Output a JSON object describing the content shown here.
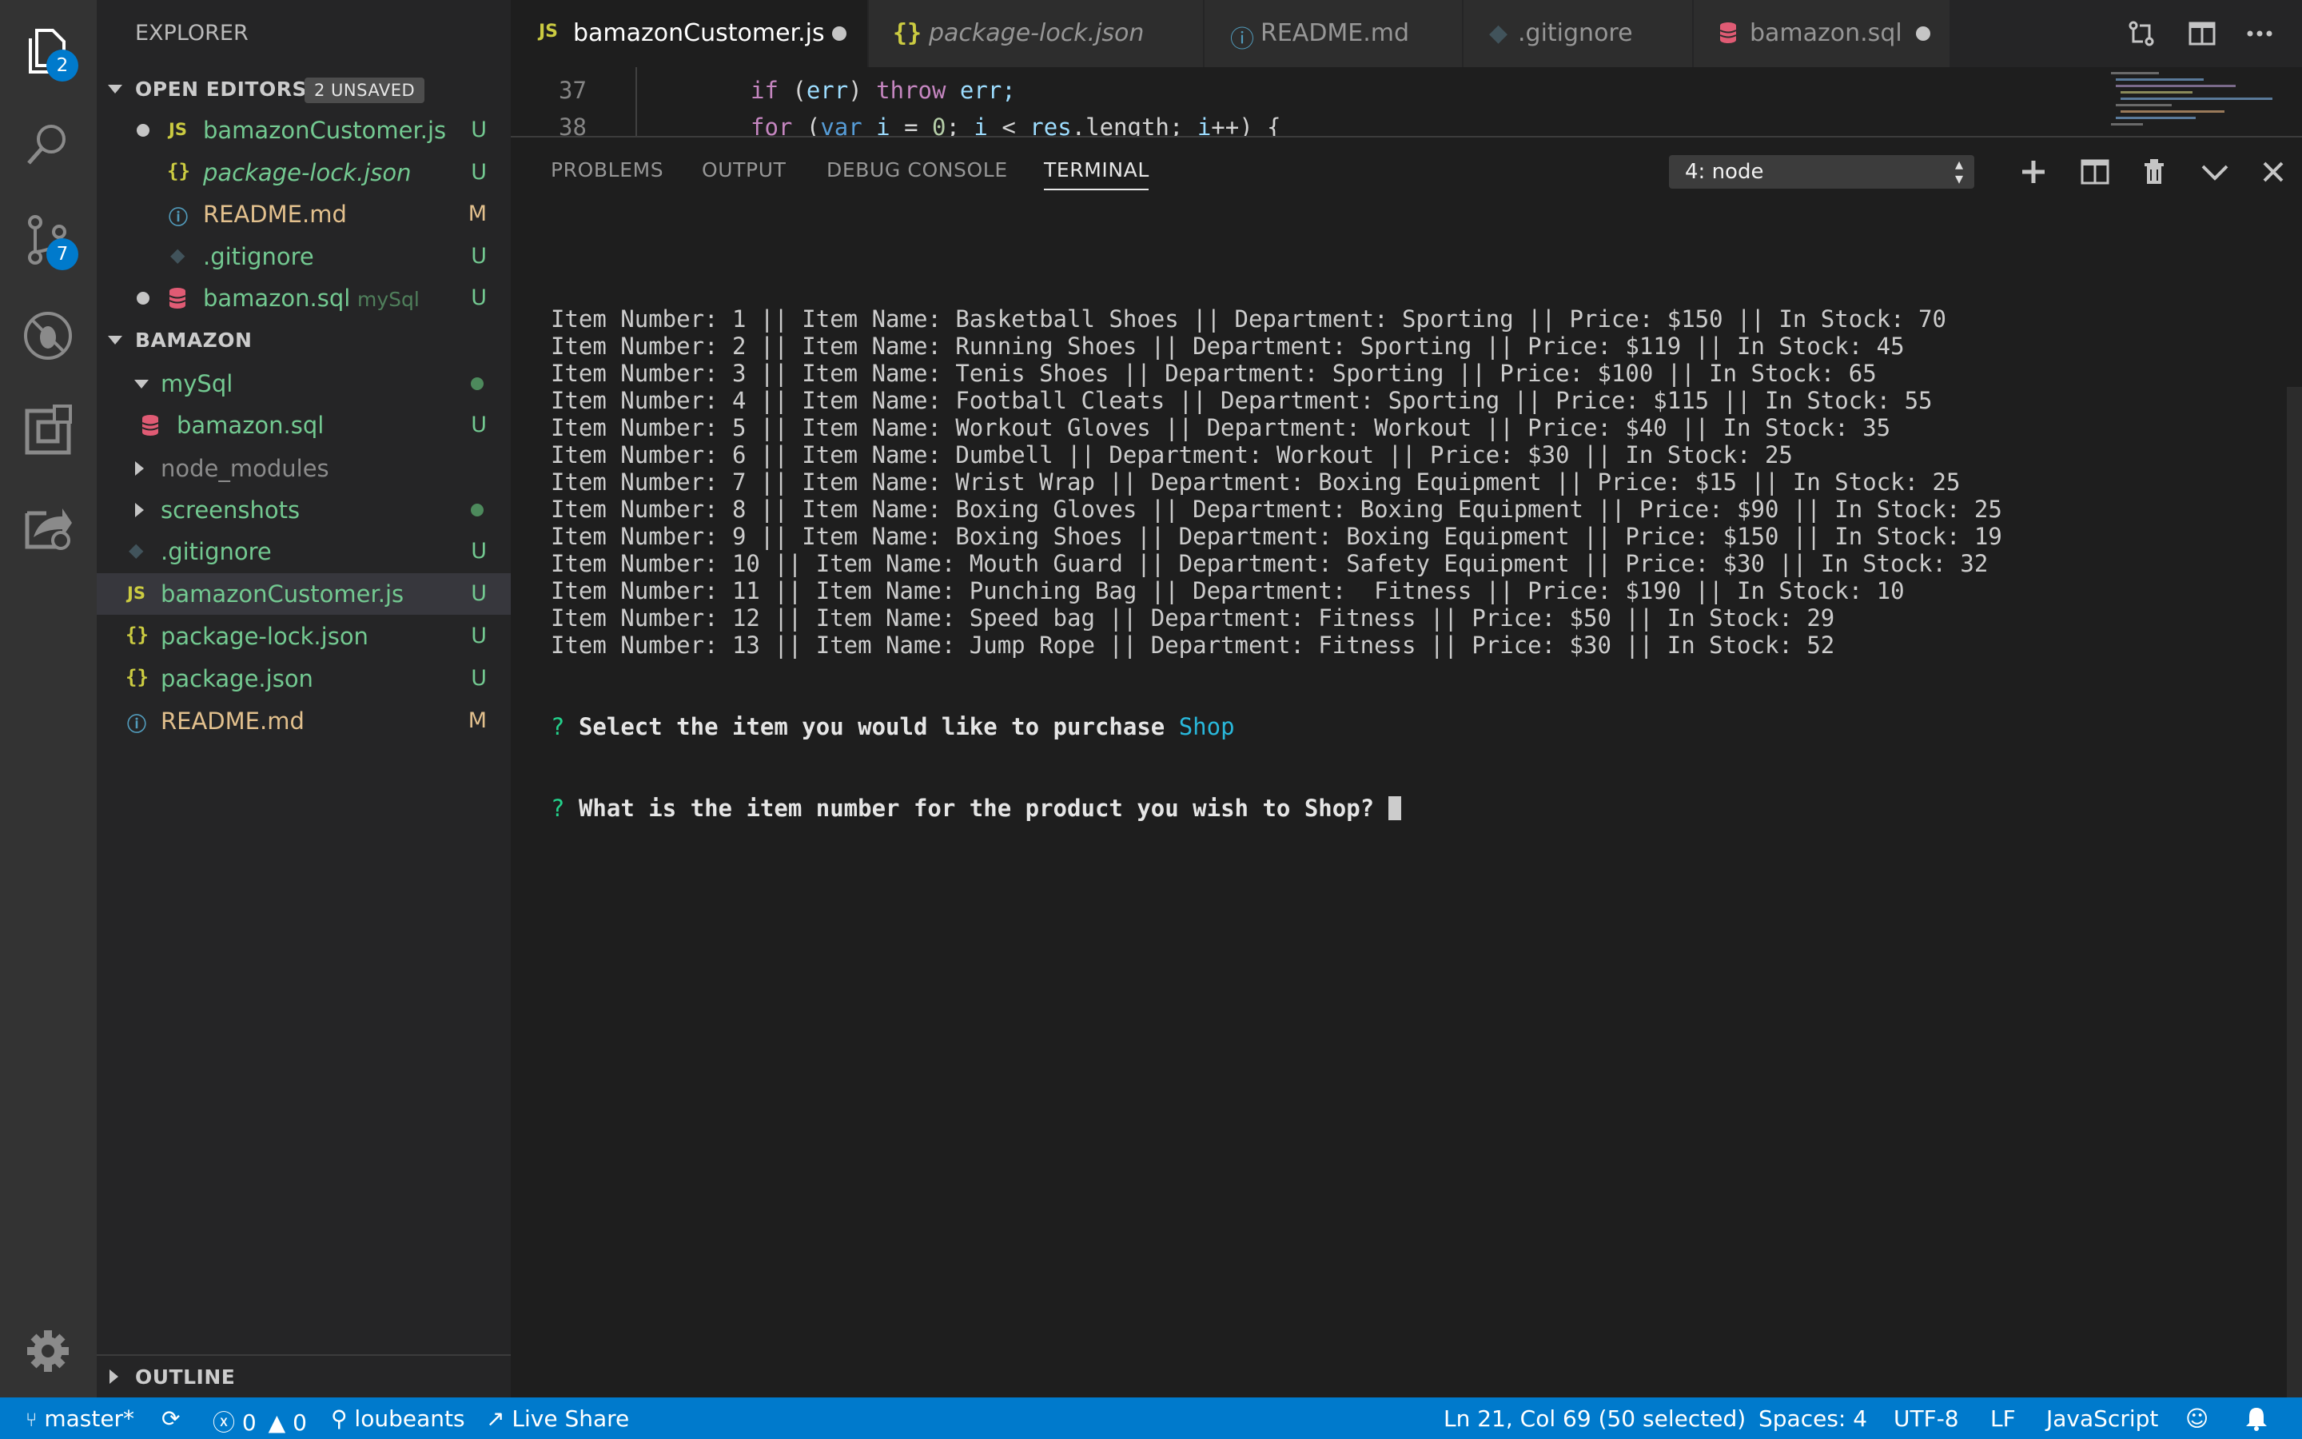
{
  "activity_bar": {
    "explorer_badge": "2",
    "scm_badge": "7"
  },
  "sidebar": {
    "title": "EXPLORER",
    "open_editors": {
      "header": "OPEN EDITORS",
      "unsaved_badge": "2 UNSAVED",
      "items": [
        {
          "name": "bamazonCustomer.js",
          "status": "U",
          "dirty": true
        },
        {
          "name": "package-lock.json",
          "status": "U"
        },
        {
          "name": "README.md",
          "status": "M"
        },
        {
          "name": ".gitignore",
          "status": "U"
        },
        {
          "name": "bamazon.sql",
          "desc": "mySql",
          "status": "U",
          "dirty": true
        }
      ]
    },
    "project": {
      "header": "BAMAZON",
      "items": [
        {
          "name": "mySql"
        },
        {
          "name": "bamazon.sql",
          "status": "U"
        },
        {
          "name": "node_modules"
        },
        {
          "name": "screenshots"
        },
        {
          "name": ".gitignore",
          "status": "U"
        },
        {
          "name": "bamazonCustomer.js",
          "status": "U"
        },
        {
          "name": "package-lock.json",
          "status": "U"
        },
        {
          "name": "package.json",
          "status": "U"
        },
        {
          "name": "README.md",
          "status": "M"
        }
      ]
    },
    "outline_header": "OUTLINE"
  },
  "tabs": [
    {
      "label": "bamazonCustomer.js",
      "icon": "JS"
    },
    {
      "label": "package-lock.json",
      "icon": "{}"
    },
    {
      "label": "README.md",
      "icon": "info"
    },
    {
      "label": ".gitignore",
      "icon": "git"
    },
    {
      "label": "bamazon.sql",
      "icon": "database"
    }
  ],
  "editor": {
    "line_numbers": [
      "37",
      "38"
    ],
    "line37": {
      "indent": "    ",
      "kw_if": "if",
      "open": " (",
      "var_err": "err",
      "close": ") ",
      "kw_throw": "throw",
      "rest": " err;"
    },
    "line38": {
      "indent": "    ",
      "kw_for": "for",
      "p1": " (",
      "kw_var": "var",
      "p2": " ",
      "var_i": "i",
      "p3": " = ",
      "zero": "0",
      "p4": "; ",
      "var_i2": "i",
      "p5": " < ",
      "var_res": "res",
      "p6": ".length; ",
      "var_i3": "i",
      "p7": "++) {"
    }
  },
  "panel": {
    "tabs": [
      "PROBLEMS",
      "OUTPUT",
      "DEBUG CONSOLE",
      "TERMINAL"
    ],
    "terminal_select": "4: node",
    "terminal_lines": [
      "Item Number: 1 || Item Name: Basketball Shoes || Department: Sporting || Price: $150 || In Stock: 70",
      "Item Number: 2 || Item Name: Running Shoes || Department: Sporting || Price: $119 || In Stock: 45",
      "Item Number: 3 || Item Name: Tenis Shoes || Department: Sporting || Price: $100 || In Stock: 65",
      "Item Number: 4 || Item Name: Football Cleats || Department: Sporting || Price: $115 || In Stock: 55",
      "Item Number: 5 || Item Name: Workout Gloves || Department: Workout || Price: $40 || In Stock: 35",
      "Item Number: 6 || Item Name: Dumbell || Department: Workout || Price: $30 || In Stock: 25",
      "Item Number: 7 || Item Name: Wrist Wrap || Department: Boxing Equipment || Price: $15 || In Stock: 25",
      "Item Number: 8 || Item Name: Boxing Gloves || Department: Boxing Equipment || Price: $90 || In Stock: 25",
      "Item Number: 9 || Item Name: Boxing Shoes || Department: Boxing Equipment || Price: $150 || In Stock: 19",
      "Item Number: 10 || Item Name: Mouth Guard || Department: Safety Equipment || Price: $30 || In Stock: 32",
      "Item Number: 11 || Item Name: Punching Bag || Department:  Fitness || Price: $190 || In Stock: 10",
      "Item Number: 12 || Item Name: Speed bag || Department: Fitness || Price: $50 || In Stock: 29",
      "Item Number: 13 || Item Name: Jump Rope || Department: Fitness || Price: $30 || In Stock: 52"
    ],
    "prompt1": {
      "mark": "?",
      "text": "Select the item you would like to purchase",
      "answer": "Shop"
    },
    "prompt2": {
      "mark": "?",
      "text": "What is the item number for the product you wish to Shop?"
    }
  },
  "statusbar": {
    "branch": "master*",
    "errors": "0",
    "warnings": "0",
    "user": "loubeants",
    "live_share": "Live Share",
    "cursor_pos": "Ln 21, Col 69 (50 selected)",
    "spaces": "Spaces: 4",
    "encoding": "UTF-8",
    "eol": "LF",
    "language": "JavaScript"
  },
  "colors": {
    "status_bar": "#007acc",
    "activity_bar": "#333333",
    "sidebar": "#252526",
    "editor": "#1e1e1e",
    "git_untracked": "#73c991",
    "git_modified": "#e2c08d"
  }
}
